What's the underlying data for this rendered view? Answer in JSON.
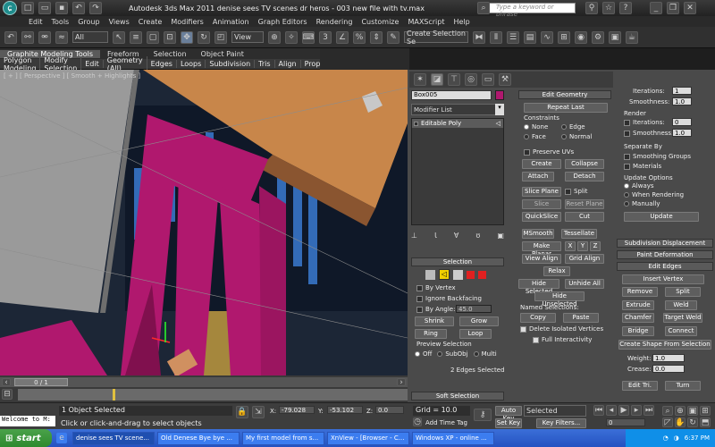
{
  "titlebar": {
    "title": "Autodesk 3ds Max  2011      denise sees TV scenes dr heros - 003  new file with tv.max",
    "search_placeholder": "Type a keyword or phrase"
  },
  "menu": [
    "Edit",
    "Tools",
    "Group",
    "Views",
    "Create",
    "Modifiers",
    "Animation",
    "Graph Editors",
    "Rendering",
    "Customize",
    "MAXScript",
    "Help"
  ],
  "toolbar": {
    "selection_filter": "All",
    "ref_coord": "View",
    "named_selection": "Create Selection Se"
  },
  "ribbon": {
    "tabs": [
      "Graphite Modeling Tools",
      "Freeform",
      "Selection",
      "Object Paint"
    ],
    "subtabs": [
      "Polygon Modeling",
      "Modify Selection",
      "Edit",
      "Geometry (All)",
      "Edges",
      "Loops",
      "Subdivision",
      "Tris",
      "Align",
      "Prop..."
    ]
  },
  "viewport": {
    "label": "[ + ] [ Perspective ] [ Smooth + Highlights ]"
  },
  "modify": {
    "object_name": "Box005",
    "modifier_list": "Modifier List",
    "stack_item": "Editable Poly"
  },
  "selection": {
    "title": "Selection",
    "by_vertex": "By Vertex",
    "ignore_backfacing": "Ignore Backfacing",
    "by_angle": "By Angle:",
    "angle_value": "45.0",
    "shrink": "Shrink",
    "grow": "Grow",
    "ring": "Ring",
    "loop": "Loop",
    "preview_title": "Preview Selection",
    "preview_off": "Off",
    "preview_subobj": "SubObj",
    "preview_multi": "Multi",
    "status": "2 Edges Selected",
    "soft_selection": "Soft Selection"
  },
  "edit_geometry": {
    "title": "Edit Geometry",
    "repeat_last": "Repeat Last",
    "constraints": "Constraints",
    "none": "None",
    "edge": "Edge",
    "face": "Face",
    "normal": "Normal",
    "preserve_uvs": "Preserve UVs",
    "create": "Create",
    "collapse": "Collapse",
    "attach": "Attach",
    "detach": "Detach",
    "slice_plane": "Slice Plane",
    "split": "Split",
    "slice": "Slice",
    "reset_plane": "Reset Plane",
    "quickslice": "QuickSlice",
    "cut": "Cut",
    "msmooth": "MSmooth",
    "tessellate": "Tessellate",
    "make_planar": "Make Planar",
    "x": "X",
    "y": "Y",
    "z": "Z",
    "view_align": "View Align",
    "grid_align": "Grid Align",
    "relax": "Relax",
    "hide_selected": "Hide Selected",
    "unhide_all": "Unhide All",
    "hide_unselected": "Hide Unselected",
    "named_selections": "Named Selections:",
    "copy": "Copy",
    "paste": "Paste",
    "delete_isolated": "Delete Isolated Vertices",
    "full_interactivity": "Full Interactivity"
  },
  "right": {
    "iterations": "Iterations:",
    "iterations_val": "1",
    "smoothness": "Smoothness:",
    "smoothness_val": "1.0",
    "render": "Render",
    "r_iterations_val": "0",
    "r_smoothness_val": "1.0",
    "separate_by": "Separate By",
    "smoothing_groups": "Smoothing Groups",
    "materials": "Materials",
    "update_options": "Update Options",
    "always": "Always",
    "when_rendering": "When Rendering",
    "manually": "Manually",
    "update": "Update",
    "subdivision_displacement": "Subdivision Displacement",
    "paint_deformation": "Paint Deformation",
    "edit_edges": "Edit Edges",
    "insert_vertex": "Insert Vertex",
    "remove": "Remove",
    "split": "Split",
    "extrude": "Extrude",
    "weld": "Weld",
    "chamfer": "Chamfer",
    "target_weld": "Target Weld",
    "bridge": "Bridge",
    "connect": "Connect",
    "create_shape": "Create Shape From Selection",
    "weight": "Weight:",
    "weight_val": "1.0",
    "crease": "Crease:",
    "crease_val": "0.0",
    "edit_tri": "Edit Tri.",
    "turn": "Turn"
  },
  "timeline": {
    "frame": "0 / 1"
  },
  "status": {
    "maxscript": "Welcome to M:",
    "objects": "1 Object Selected",
    "prompt": "Click or click-and-drag to select objects",
    "x_label": "X:",
    "x": "-79.028",
    "y_label": "Y:",
    "y": "-53.102",
    "z_label": "Z:",
    "z": "0.0",
    "grid": "Grid = 10.0",
    "add_time_tag": "Add Time Tag",
    "autokey": "Auto Key",
    "autokey_val": "Selected",
    "setkey": "Set Key",
    "key_filters": "Key Filters...",
    "frame_val": "0"
  },
  "taskbar": {
    "start": "start",
    "items": [
      "denise sees TV scene...",
      "Old Denese Bye bye ...",
      "My first model from s...",
      "XnView - [Browser - C...",
      "Windows XP - online ..."
    ],
    "time": "6:37 PM"
  },
  "colors": {
    "magenta": "#b0186e",
    "orange": "#c8864a",
    "yellow_active": "#f2d000"
  }
}
